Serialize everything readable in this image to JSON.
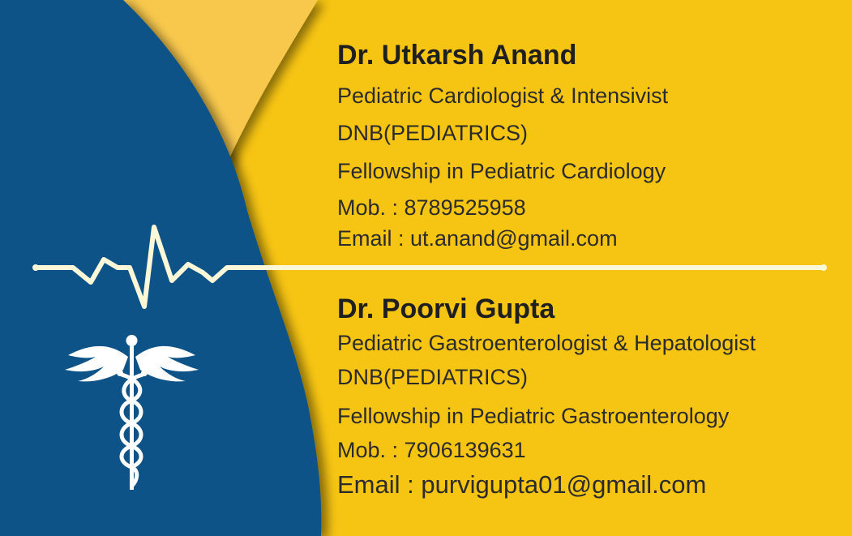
{
  "colors": {
    "background_yellow": "#F6C413",
    "accent_light_yellow": "#F8C84E",
    "blue_panel": "#0B5387",
    "emblem": "#FFFFFF",
    "ecg_line": "#FFF8D8"
  },
  "doctors": [
    {
      "name": "Dr. Utkarsh Anand",
      "specialty": "Pediatric Cardiologist & Intensivist",
      "degree": "DNB(PEDIATRICS)",
      "fellowship": "Fellowship in Pediatric Cardiology",
      "mobile": "Mob. : 8789525958",
      "email": "Email : ut.anand@gmail.com"
    },
    {
      "name": "Dr. Poorvi Gupta",
      "specialty": "Pediatric Gastroenterologist & Hepatologist",
      "degree": "DNB(PEDIATRICS)",
      "fellowship": "Fellowship in Pediatric Gastroenterology",
      "mobile": "Mob. : 7906139631",
      "email": "Email : purvigupta01@gmail.com"
    }
  ],
  "icons": {
    "ecg": "heartbeat-line-icon",
    "emblem": "caduceus-icon"
  }
}
